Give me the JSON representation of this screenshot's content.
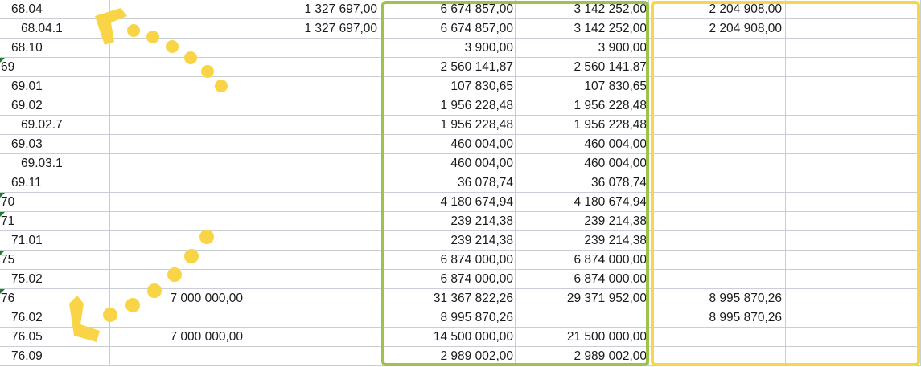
{
  "colors": {
    "green_highlight": "#9cc44a",
    "yellow_highlight": "#f7d54e",
    "dots": "#f9d447",
    "comment_marker": "#1f7a2e",
    "gridline": "#c9ced6"
  },
  "rows": [
    {
      "code": "68.04",
      "b": "",
      "c": "1 327 697,00",
      "d": "6 674 857,00",
      "e": "3 142 252,00",
      "f": "2 204 908,00",
      "g": ""
    },
    {
      "code": "68.04.1",
      "b": "",
      "c": "1 327 697,00",
      "d": "6 674 857,00",
      "e": "3 142 252,00",
      "f": "2 204 908,00",
      "g": ""
    },
    {
      "code": "68.10",
      "b": "",
      "c": "",
      "d": "3 900,00",
      "e": "3 900,00",
      "f": "",
      "g": ""
    },
    {
      "code": "69",
      "b": "",
      "c": "",
      "d": "2 560 141,87",
      "e": "2 560 141,87",
      "f": "",
      "g": ""
    },
    {
      "code": "69.01",
      "b": "",
      "c": "",
      "d": "107 830,65",
      "e": "107 830,65",
      "f": "",
      "g": ""
    },
    {
      "code": "69.02",
      "b": "",
      "c": "",
      "d": "1 956 228,48",
      "e": "1 956 228,48",
      "f": "",
      "g": ""
    },
    {
      "code": "69.02.7",
      "b": "",
      "c": "",
      "d": "1 956 228,48",
      "e": "1 956 228,48",
      "f": "",
      "g": ""
    },
    {
      "code": "69.03",
      "b": "",
      "c": "",
      "d": "460 004,00",
      "e": "460 004,00",
      "f": "",
      "g": ""
    },
    {
      "code": "69.03.1",
      "b": "",
      "c": "",
      "d": "460 004,00",
      "e": "460 004,00",
      "f": "",
      "g": ""
    },
    {
      "code": "69.11",
      "b": "",
      "c": "",
      "d": "36 078,74",
      "e": "36 078,74",
      "f": "",
      "g": ""
    },
    {
      "code": "70",
      "b": "",
      "c": "",
      "d": "4 180 674,94",
      "e": "4 180 674,94",
      "f": "",
      "g": ""
    },
    {
      "code": "71",
      "b": "",
      "c": "",
      "d": "239 214,38",
      "e": "239 214,38",
      "f": "",
      "g": ""
    },
    {
      "code": "71.01",
      "b": "",
      "c": "",
      "d": "239 214,38",
      "e": "239 214,38",
      "f": "",
      "g": ""
    },
    {
      "code": "75",
      "b": "",
      "c": "",
      "d": "6 874 000,00",
      "e": "6 874 000,00",
      "f": "",
      "g": ""
    },
    {
      "code": "75.02",
      "b": "",
      "c": "",
      "d": "6 874 000,00",
      "e": "6 874 000,00",
      "f": "",
      "g": ""
    },
    {
      "code": "76",
      "b": "7 000 000,00",
      "c": "",
      "d": "31 367 822,26",
      "e": "29 371 952,00",
      "f": "8 995 870,26",
      "g": ""
    },
    {
      "code": "76.02",
      "b": "",
      "c": "",
      "d": "8 995 870,26",
      "e": "",
      "f": "8 995 870,26",
      "g": ""
    },
    {
      "code": "76.05",
      "b": "7 000 000,00",
      "c": "",
      "d": "14 500 000,00",
      "e": "21 500 000,00",
      "f": "",
      "g": ""
    },
    {
      "code": "76.09",
      "b": "",
      "c": "",
      "d": "2 989 002,00",
      "e": "2 989 002,00",
      "f": "",
      "g": ""
    }
  ]
}
